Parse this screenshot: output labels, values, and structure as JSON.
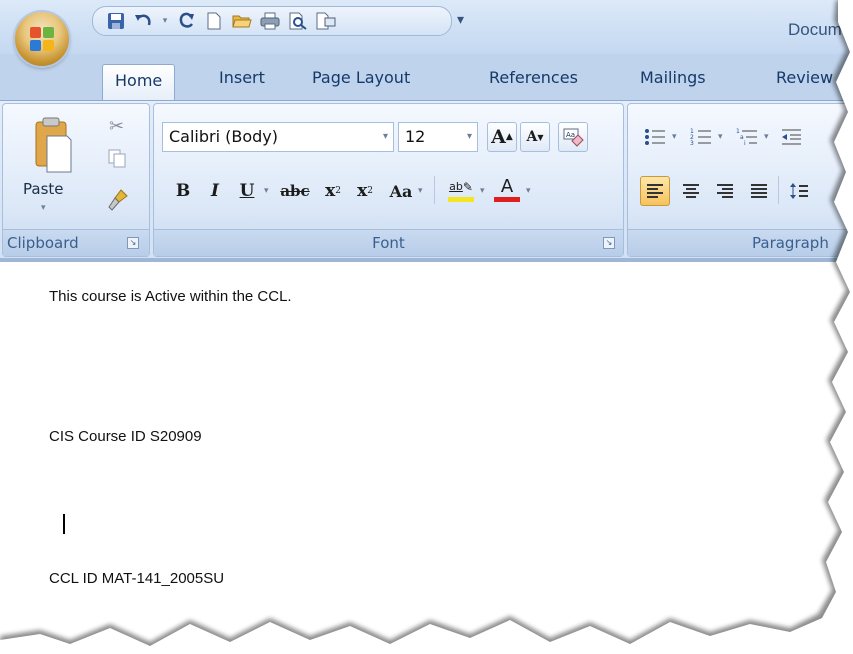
{
  "title_bar": {
    "document_title": "Docum",
    "qat_icons": [
      "save-icon",
      "undo-icon",
      "redo-icon",
      "new-document-icon",
      "open-folder-icon",
      "quick-print-icon",
      "print-preview-icon",
      "attach-icon"
    ],
    "customize_glyph": "▾"
  },
  "tabs": [
    {
      "label": "Home",
      "active": true
    },
    {
      "label": "Insert",
      "active": false
    },
    {
      "label": "Page Layout",
      "active": false
    },
    {
      "label": "References",
      "active": false
    },
    {
      "label": "Mailings",
      "active": false
    },
    {
      "label": "Review",
      "active": false
    }
  ],
  "ribbon": {
    "clipboard": {
      "group_label": "Clipboard",
      "paste_label": "Paste"
    },
    "font": {
      "group_label": "Font",
      "font_name": "Calibri (Body)",
      "font_size": "12",
      "bold": "B",
      "italic": "I",
      "underline": "U",
      "strikethrough": "abc",
      "subscript": "x",
      "subscript_mark": "2",
      "superscript": "x",
      "superscript_mark": "2",
      "change_case": "Aa",
      "grow_font": "A",
      "shrink_font": "A",
      "highlight": "ab",
      "font_color": "A",
      "highlight_color": "#f5e624",
      "font_color_bar": "#e01e1e"
    },
    "paragraph": {
      "group_label": "Paragraph"
    }
  },
  "document": {
    "lines": [
      "This course is Active within the CCL.",
      "CIS Course ID S20909",
      "CCL ID MAT-141_2005SU"
    ]
  }
}
